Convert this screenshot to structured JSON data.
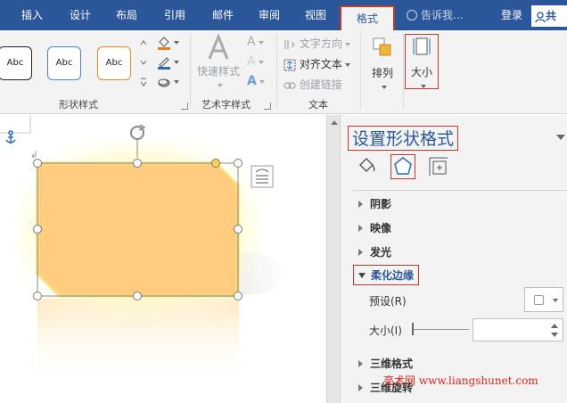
{
  "tabs": [
    {
      "label": "插入"
    },
    {
      "label": "设计"
    },
    {
      "label": "布局"
    },
    {
      "label": "引用"
    },
    {
      "label": "邮件"
    },
    {
      "label": "审阅"
    },
    {
      "label": "视图"
    },
    {
      "label": "格式"
    }
  ],
  "tell_me": "告诉我...",
  "login": "登录",
  "share": "共",
  "ribbon": {
    "shape_style_presets": [
      {
        "label": "Abc",
        "border": "#222222"
      },
      {
        "label": "Abc",
        "border": "#4a86c8"
      },
      {
        "label": "Abc",
        "border": "#e38b2c"
      }
    ],
    "shape_styles_label": "形状样式",
    "quick_styles_label": "快速样式",
    "wordart_styles_label": "艺术字样式",
    "text_direction": "文字方向",
    "align_text": "对齐文本",
    "create_link": "创建链接",
    "text_group_label": "文本",
    "arrange": "排列",
    "size": "大小"
  },
  "pane": {
    "title": "设置形状格式",
    "sections": {
      "shadow": "阴影",
      "reflection": "映像",
      "glow": "发光",
      "soft_edges": "柔化边缘",
      "format_3d": "三维格式",
      "rotation_3d": "三维旋转"
    },
    "preset_label": "预设(R)",
    "size_label": "大小(I)",
    "size_value": ""
  },
  "watermark": "亮术网 www.liangshunet.com",
  "colors": {
    "ribbon_blue": "#2b579a",
    "shape_fill": "#ffcc80",
    "highlight_red": "#c0392b"
  }
}
